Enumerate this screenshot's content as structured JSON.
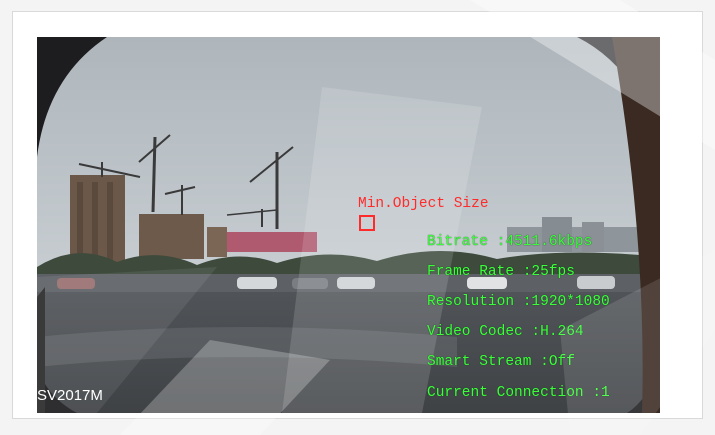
{
  "overlay": {
    "min_object_label": "Min.Object Size",
    "device_name": "SV2017M",
    "stats": [
      {
        "key": "bitrate",
        "text": "Bitrate :4511.6kbps"
      },
      {
        "key": "frame-rate",
        "text": "Frame Rate :25fps"
      },
      {
        "key": "resolution",
        "text": "Resolution :1920*1080"
      },
      {
        "key": "video-codec",
        "text": "Video Codec :H.264"
      },
      {
        "key": "smart-stream",
        "text": "Smart Stream :Off"
      },
      {
        "key": "current-connection",
        "text": "Current Connection :1"
      }
    ]
  },
  "colors": {
    "osd_text": "#3cff3c",
    "min_object": "#ff2b2b",
    "device_text": "#ffffff"
  }
}
